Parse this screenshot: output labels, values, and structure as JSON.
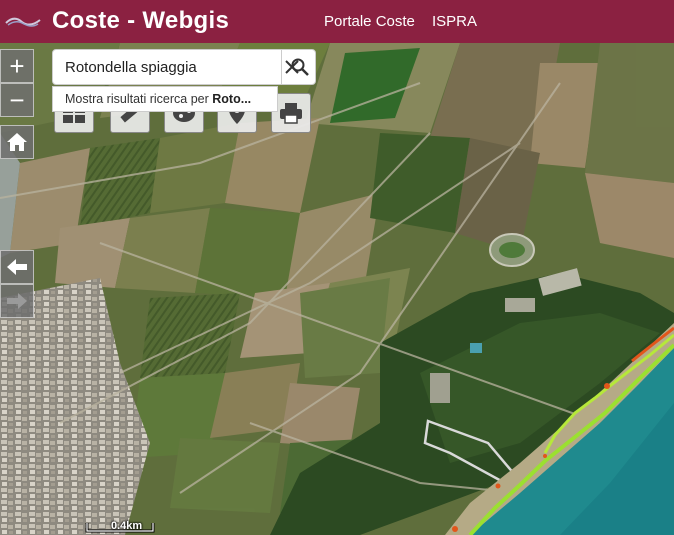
{
  "header": {
    "title": "Coste - Webgis",
    "nav": [
      "Portale Coste",
      "ISPRA"
    ]
  },
  "search": {
    "value": "Rotondella spiaggia",
    "placeholder": "",
    "suggestion_prefix": "Mostra risultati ricerca per ",
    "suggestion_term": "Roto..."
  },
  "controls": {
    "zoom_in": "+",
    "zoom_out": "−"
  },
  "icons": {
    "zoom_in": "plus-icon",
    "zoom_out": "minus-icon",
    "home": "home-icon",
    "back": "arrow-left-icon",
    "forward": "arrow-right-icon",
    "clear": "close-icon",
    "search": "search-icon",
    "tools": [
      "layers-icon",
      "ruler-icon",
      "palette-icon",
      "location-pin-icon",
      "printer-icon"
    ]
  },
  "scale_bar": {
    "label": "0.4km"
  },
  "colors": {
    "header": "#8b2141",
    "sea": "#1f8a8e",
    "shoreline_green": "#9be030",
    "shoreline_red": "#e2561b",
    "aoi_outline": "#d9d9d9"
  }
}
